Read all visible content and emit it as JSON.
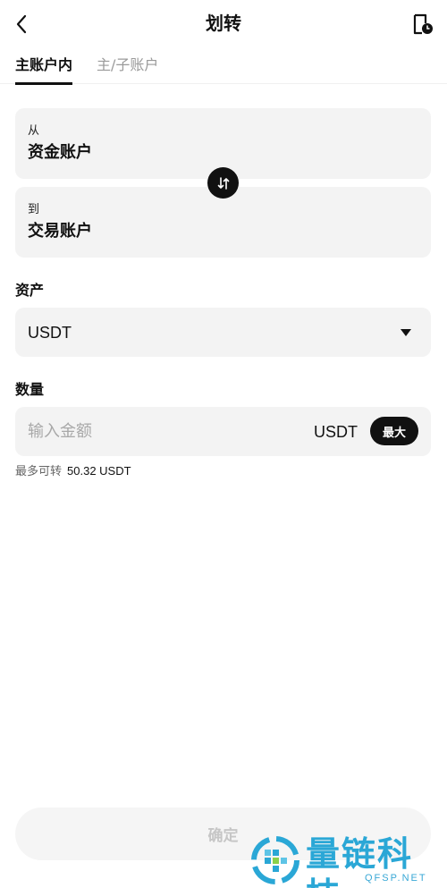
{
  "header": {
    "title": "划转",
    "back_icon": "chevron-left-icon",
    "record_icon": "transfer-record-icon"
  },
  "tabs": [
    {
      "label": "主账户内",
      "active": true
    },
    {
      "label": "主/子账户",
      "active": false
    }
  ],
  "from": {
    "label": "从",
    "account": "资金账户"
  },
  "to": {
    "label": "到",
    "account": "交易账户"
  },
  "swap_icon": "swap-arrows-icon",
  "asset": {
    "label": "资产",
    "value": "USDT"
  },
  "quantity": {
    "label": "数量",
    "placeholder": "输入金额",
    "unit": "USDT",
    "max_label": "最大"
  },
  "available": {
    "label": "最多可转",
    "value": "50.32 USDT"
  },
  "confirm_label": "确定",
  "watermark": {
    "name": "量链科技",
    "domain": "QFSP.NET"
  },
  "colors": {
    "accent": "#111111",
    "card_bg": "#f3f3f3",
    "watermark": "#2aa7d6"
  }
}
